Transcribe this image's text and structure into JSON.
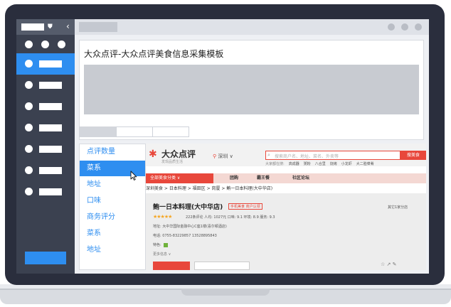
{
  "panel": {
    "title": "大众点评-大众点评美食信息采集模板"
  },
  "field_list": [
    {
      "label": "点评数量",
      "active": false
    },
    {
      "label": "菜系",
      "active": true
    },
    {
      "label": "地址",
      "active": false
    },
    {
      "label": "口味",
      "active": false
    },
    {
      "label": "商务评分",
      "active": false
    },
    {
      "label": "菜系",
      "active": false
    },
    {
      "label": "地址",
      "active": false
    }
  ],
  "web": {
    "logo": "大众点评",
    "logo_sub": "发现品质生活",
    "city": "深圳",
    "search_placeholder": "搜索商户名、地址、菜名、外卖等",
    "search_button": "搜美食",
    "hot_label": "大家都在搜:",
    "hot_items": [
      "高成器",
      "粥粉",
      "八合里",
      "烧烤",
      "小龙虾",
      "大二脸菜肴"
    ],
    "nav_category": "全部美食分类",
    "nav_items": [
      "团购",
      "霸王餐",
      "社区论坛"
    ],
    "breadcrumb": "深圳美食 > 日本料理 > 福田区 > 岗厦 > 鲔一日本料理(大中华店)",
    "shop_name": "鲔一日本料理(大中华店)",
    "shop_badge": "手机美食 商户认领",
    "branch": "其它1家分店",
    "stars": "★★★★★",
    "stats": "222条评论   人均: 1027元   口味: 9.1   环境: 8.9   服务: 9.3",
    "address": "地址:  大中华国际金融中心C座1楼(喜尔顿酒店)",
    "phone": "电话:  0755-83229857 13528895843",
    "feature": "特色:",
    "more": "更多信息 ∨",
    "action_icons": "☆  ↗  ✎"
  },
  "colors": {
    "accent": "#2e8ef0",
    "sidebar": "#3b4150",
    "brand_red": "#e8473b"
  }
}
